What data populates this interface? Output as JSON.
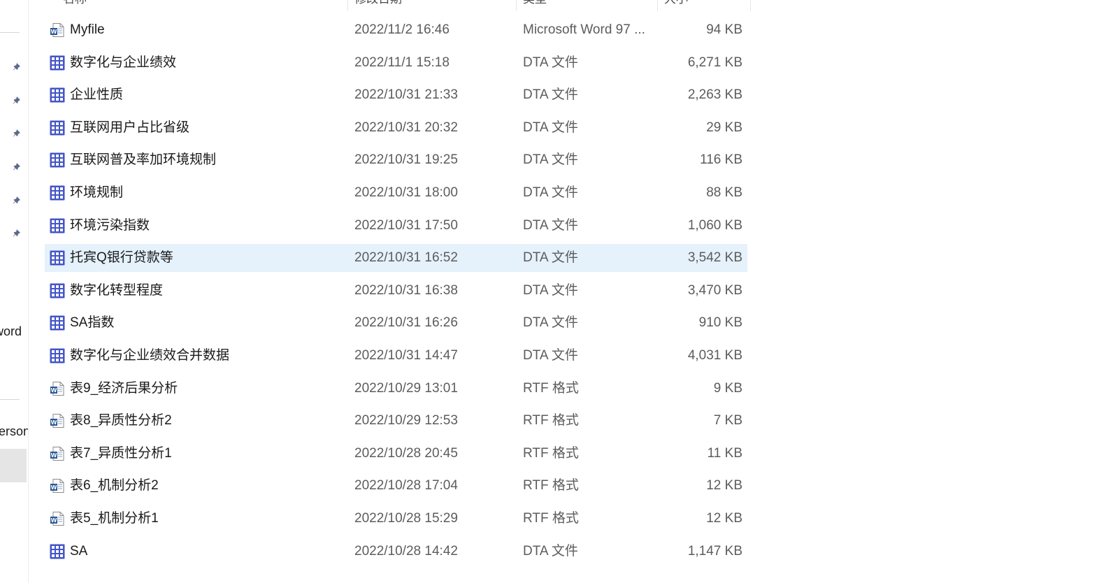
{
  "header": {
    "name_label": "名称",
    "date_label": "修改日期",
    "type_label": "类型",
    "size_label": "大小"
  },
  "nav": {
    "item_word": "word",
    "item_person": "erson"
  },
  "rows": [
    {
      "icon": "word-document-icon",
      "name": "Myfile",
      "date": "2022/11/2 16:46",
      "type": "Microsoft Word 97 ...",
      "size": "94 KB"
    },
    {
      "icon": "dta-file-icon",
      "name": "数字化与企业绩效",
      "date": "2022/11/1 15:18",
      "type": "DTA 文件",
      "size": "6,271 KB"
    },
    {
      "icon": "dta-file-icon",
      "name": "企业性质",
      "date": "2022/10/31 21:33",
      "type": "DTA 文件",
      "size": "2,263 KB"
    },
    {
      "icon": "dta-file-icon",
      "name": "互联网用户占比省级",
      "date": "2022/10/31 20:32",
      "type": "DTA 文件",
      "size": "29 KB"
    },
    {
      "icon": "dta-file-icon",
      "name": "互联网普及率加环境规制",
      "date": "2022/10/31 19:25",
      "type": "DTA 文件",
      "size": "116 KB"
    },
    {
      "icon": "dta-file-icon",
      "name": "环境规制",
      "date": "2022/10/31 18:00",
      "type": "DTA 文件",
      "size": "88 KB"
    },
    {
      "icon": "dta-file-icon",
      "name": "环境污染指数",
      "date": "2022/10/31 17:50",
      "type": "DTA 文件",
      "size": "1,060 KB"
    },
    {
      "icon": "dta-file-icon",
      "name": "托宾Q银行贷款等",
      "date": "2022/10/31 16:52",
      "type": "DTA 文件",
      "size": "3,542 KB",
      "selected": true
    },
    {
      "icon": "dta-file-icon",
      "name": "数字化转型程度",
      "date": "2022/10/31 16:38",
      "type": "DTA 文件",
      "size": "3,470 KB"
    },
    {
      "icon": "dta-file-icon",
      "name": "SA指数",
      "date": "2022/10/31 16:26",
      "type": "DTA 文件",
      "size": "910 KB"
    },
    {
      "icon": "dta-file-icon",
      "name": "数字化与企业绩效合并数据",
      "date": "2022/10/31 14:47",
      "type": "DTA 文件",
      "size": "4,031 KB"
    },
    {
      "icon": "word-document-icon",
      "name": "表9_经济后果分析",
      "date": "2022/10/29 13:01",
      "type": "RTF 格式",
      "size": "9 KB"
    },
    {
      "icon": "word-document-icon",
      "name": "表8_异质性分析2",
      "date": "2022/10/29 12:53",
      "type": "RTF 格式",
      "size": "7 KB"
    },
    {
      "icon": "word-document-icon",
      "name": "表7_异质性分析1",
      "date": "2022/10/28 20:45",
      "type": "RTF 格式",
      "size": "11 KB"
    },
    {
      "icon": "word-document-icon",
      "name": "表6_机制分析2",
      "date": "2022/10/28 17:04",
      "type": "RTF 格式",
      "size": "12 KB"
    },
    {
      "icon": "word-document-icon",
      "name": "表5_机制分析1",
      "date": "2022/10/28 15:29",
      "type": "RTF 格式",
      "size": "12 KB"
    },
    {
      "icon": "dta-file-icon",
      "name": "SA",
      "date": "2022/10/28 14:42",
      "type": "DTA 文件",
      "size": "1,147 KB"
    }
  ],
  "colors": {
    "selected_row": "#e5f1fb",
    "dta_icon": "#4355c7",
    "word_icon": "#2b5797",
    "pin_icon": "#5b6a8a"
  }
}
